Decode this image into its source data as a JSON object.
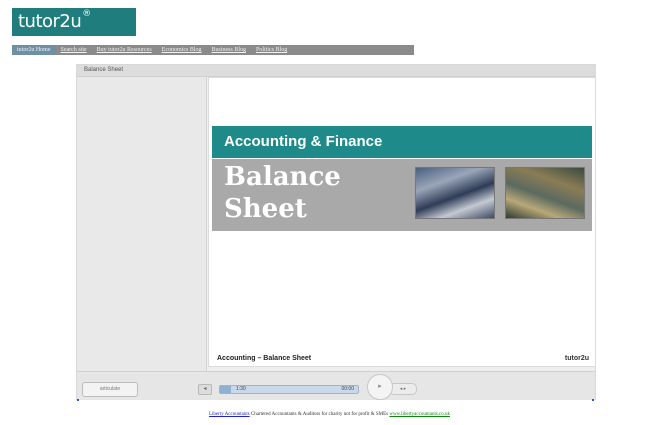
{
  "logo": {
    "text": "tutor2u",
    "mark": "®"
  },
  "nav": {
    "items": [
      "tutor2u Home",
      "Search site",
      "Buy tutor2u Resources",
      "Economics Blog",
      "Business Blog",
      "Politics Blog"
    ]
  },
  "viewer": {
    "frame_title": "Balance Sheet",
    "slide": {
      "band_title": "Accounting & Finance",
      "main_title": "Balance Sheet",
      "footer_left": "Accounting – Balance Sheet",
      "footer_logo": "tutor2u"
    },
    "controls": {
      "brand_button": "articulate",
      "prev_icon": "◂",
      "time_current": "1:30",
      "time_total": "00:00",
      "play_icon": "▸",
      "next_group": "◂ ▸",
      "progress": 0.08
    }
  },
  "footer": {
    "link": "Liberty Accountants",
    "text": "Chartered Accountants & Auditors for charity not for profit & SMEs",
    "url": "www.libertyaccountants.co.uk"
  },
  "colors": {
    "brand_teal": "#1f7d7d",
    "slide_teal": "#1e8a8a",
    "slide_grey": "#a9a9a9",
    "nav_grey": "#8a8a8a"
  },
  "icons": [
    "previous-icon",
    "play-icon",
    "next-icon"
  ]
}
